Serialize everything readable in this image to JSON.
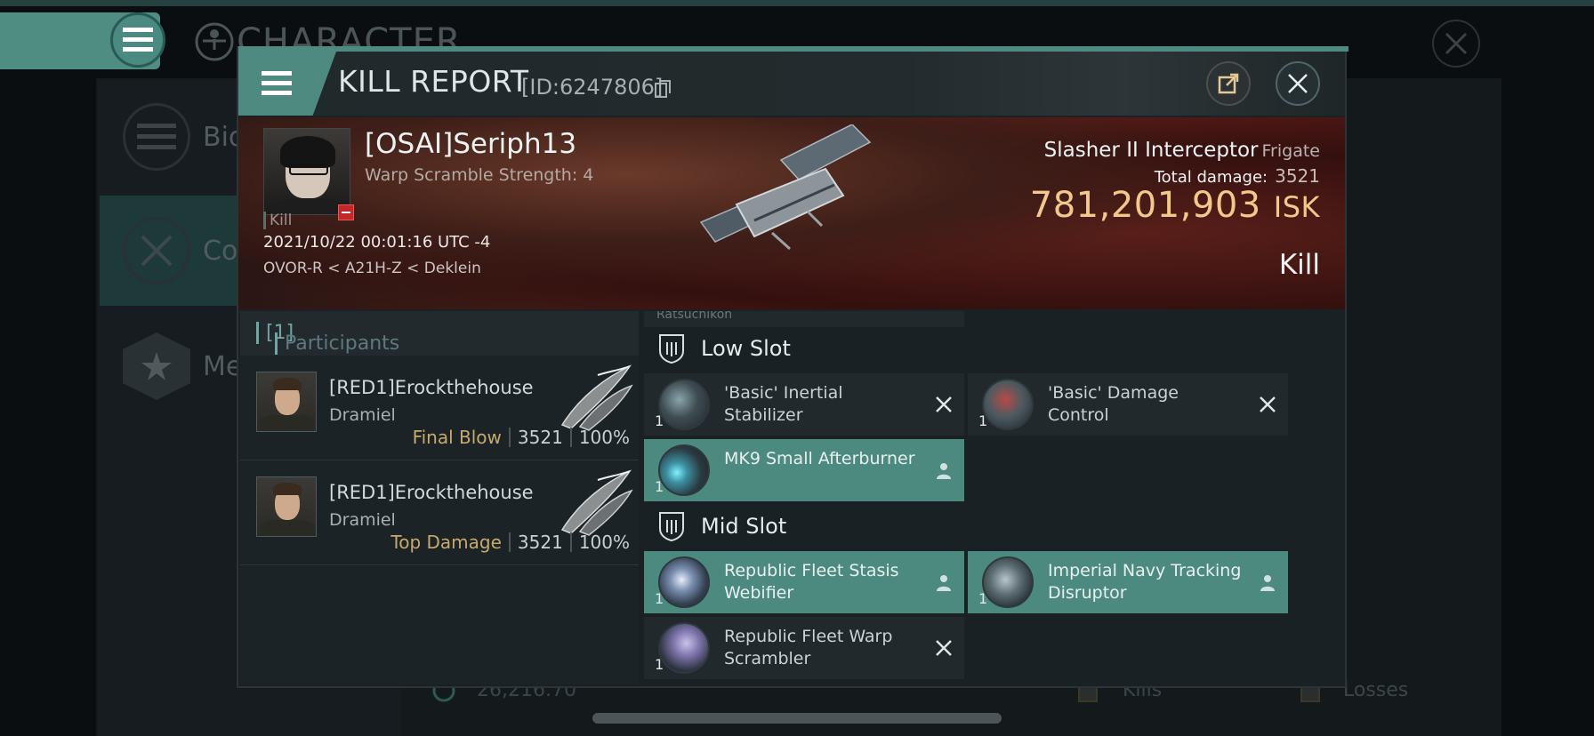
{
  "background": {
    "title": "CHARACTER",
    "sidebar": [
      {
        "label": "Bio"
      },
      {
        "label": "Co"
      },
      {
        "label": "Me"
      }
    ],
    "footer": {
      "isk_value": "26,216.70",
      "kills_label": "Kills",
      "losses_label": "Losses"
    }
  },
  "window": {
    "title": "KILL REPORT",
    "report_id": "[ID:6247806]",
    "accent_color": "#4f8a80"
  },
  "victim": {
    "name": "[OSAI]Seriph13",
    "subtitle": "Warp Scramble Strength: 4",
    "kill_tag": "Kill",
    "datetime": "2021/10/22 00:01:16 UTC -4",
    "location": "OVOR-R < A21H-Z < Deklein",
    "ship_name": "Slasher II Interceptor",
    "ship_class": "Frigate",
    "total_damage_label": "Total damage:",
    "total_damage": "3521",
    "isk_value": "781,201,903",
    "isk_unit": "ISK",
    "result": "Kill"
  },
  "participants": {
    "header_label": "Participants",
    "header_count": "[1]",
    "rows": [
      {
        "name": "[RED1]Erockthehouse",
        "ship": "Dramiel",
        "tag": "Final Blow",
        "damage": "3521",
        "percent": "100%"
      },
      {
        "name": "[RED1]Erockthehouse",
        "ship": "Dramiel",
        "tag": "Top Damage",
        "damage": "3521",
        "percent": "100%"
      }
    ]
  },
  "fitting": {
    "previous_item": "Ratsuchikon",
    "low_slot": {
      "label": "Low Slot",
      "modules": [
        {
          "qty": "1",
          "name": "'Basic' Inertial Stabilizer",
          "state": "destroyed"
        },
        {
          "qty": "1",
          "name": "'Basic' Damage Control",
          "state": "destroyed"
        },
        {
          "qty": "1",
          "name": "MK9 Small Afterburner",
          "state": "dropped"
        }
      ]
    },
    "mid_slot": {
      "label": "Mid Slot",
      "modules": [
        {
          "qty": "1",
          "name": "Republic Fleet Stasis Webifier",
          "state": "dropped"
        },
        {
          "qty": "1",
          "name": "Imperial Navy Tracking Disruptor",
          "state": "dropped"
        },
        {
          "qty": "1",
          "name": "Republic Fleet Warp Scrambler",
          "state": "destroyed"
        }
      ]
    }
  }
}
